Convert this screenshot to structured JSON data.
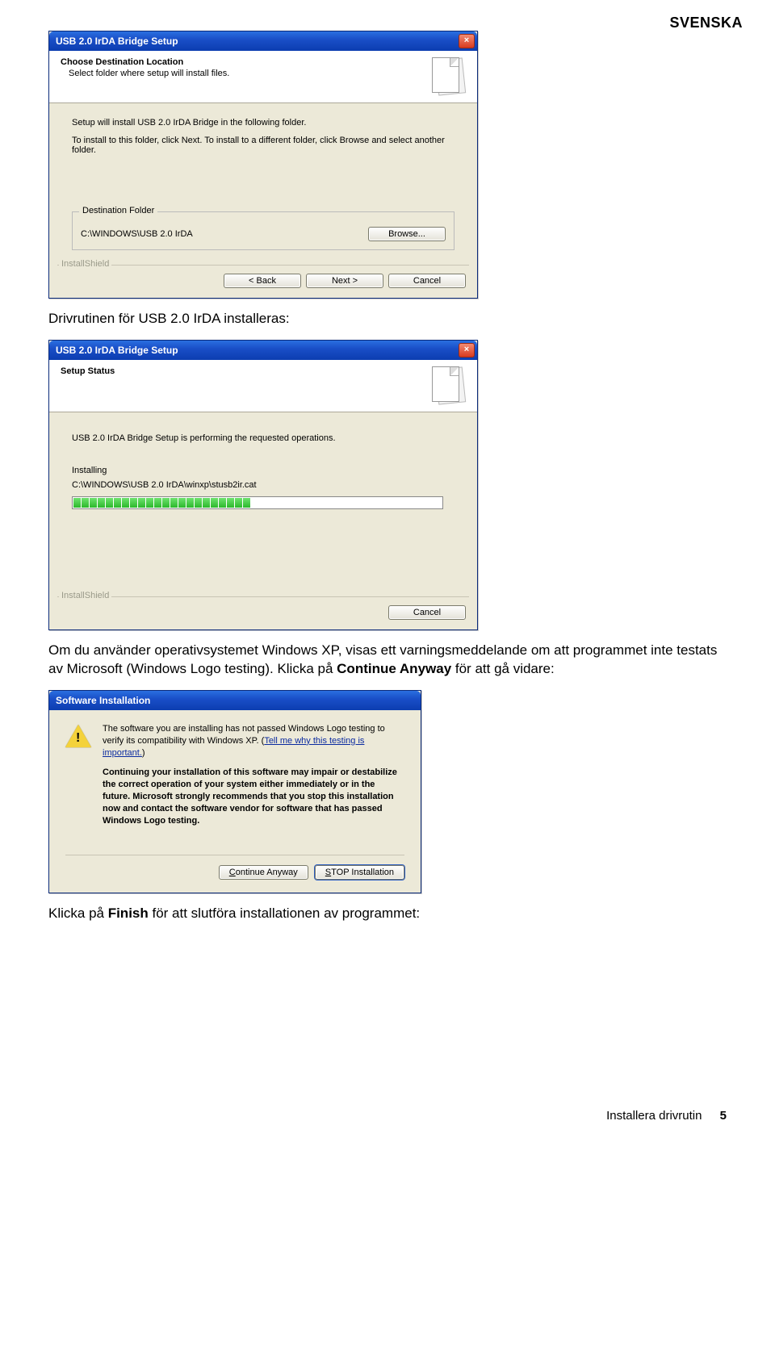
{
  "page": {
    "top_label": "SVENSKA",
    "text1": "Drivrutinen för USB 2.0 IrDA installeras:",
    "text2_a": "Om du använder operativsystemet Windows XP, visas ett varningsmeddelande om att programmet inte testats av Microsoft (Windows Logo testing). Klicka på ",
    "text2_b": "Continue Anyway",
    "text2_c": " för att gå vidare:",
    "text3_a": "Klicka på ",
    "text3_b": "Finish",
    "text3_c": " för att slutföra installationen av programmet:",
    "footer_label": "Installera drivrutin",
    "footer_page": "5"
  },
  "dlg1": {
    "title": "USB 2.0 IrDA Bridge Setup",
    "heading": "Choose Destination Location",
    "subheading": "Select folder where setup will install files.",
    "body1": "Setup will install USB 2.0 IrDA Bridge in the following folder.",
    "body2": "To install to this folder, click Next. To install to a different folder, click Browse and select another folder.",
    "group_legend": "Destination Folder",
    "dest_path": "C:\\WINDOWS\\USB 2.0 IrDA",
    "browse": "Browse...",
    "ishield": "InstallShield",
    "back": "< Back",
    "next": "Next >",
    "cancel": "Cancel"
  },
  "dlg2": {
    "title": "USB 2.0 IrDA Bridge Setup",
    "heading": "Setup Status",
    "body1": "USB 2.0 IrDA Bridge Setup is performing the requested operations.",
    "body2": "Installing",
    "path": "C:\\WINDOWS\\USB 2.0 IrDA\\winxp\\stusb2ir.cat",
    "ishield": "InstallShield",
    "cancel": "Cancel"
  },
  "dlg3": {
    "title": "Software Installation",
    "para1a": "The software you are installing has not passed Windows Logo testing to verify its compatibility with Windows XP. (",
    "link": "Tell me why this testing is important.",
    "para1b": ")",
    "para2": "Continuing your installation of this software may impair or destabilize the correct operation of your system either immediately or in the future. Microsoft strongly recommends that you stop this installation now and contact the software vendor for software that has passed Windows Logo testing.",
    "continue_u": "C",
    "continue_rest": "ontinue Anyway",
    "stop_u": "S",
    "stop_rest": "TOP Installation"
  }
}
